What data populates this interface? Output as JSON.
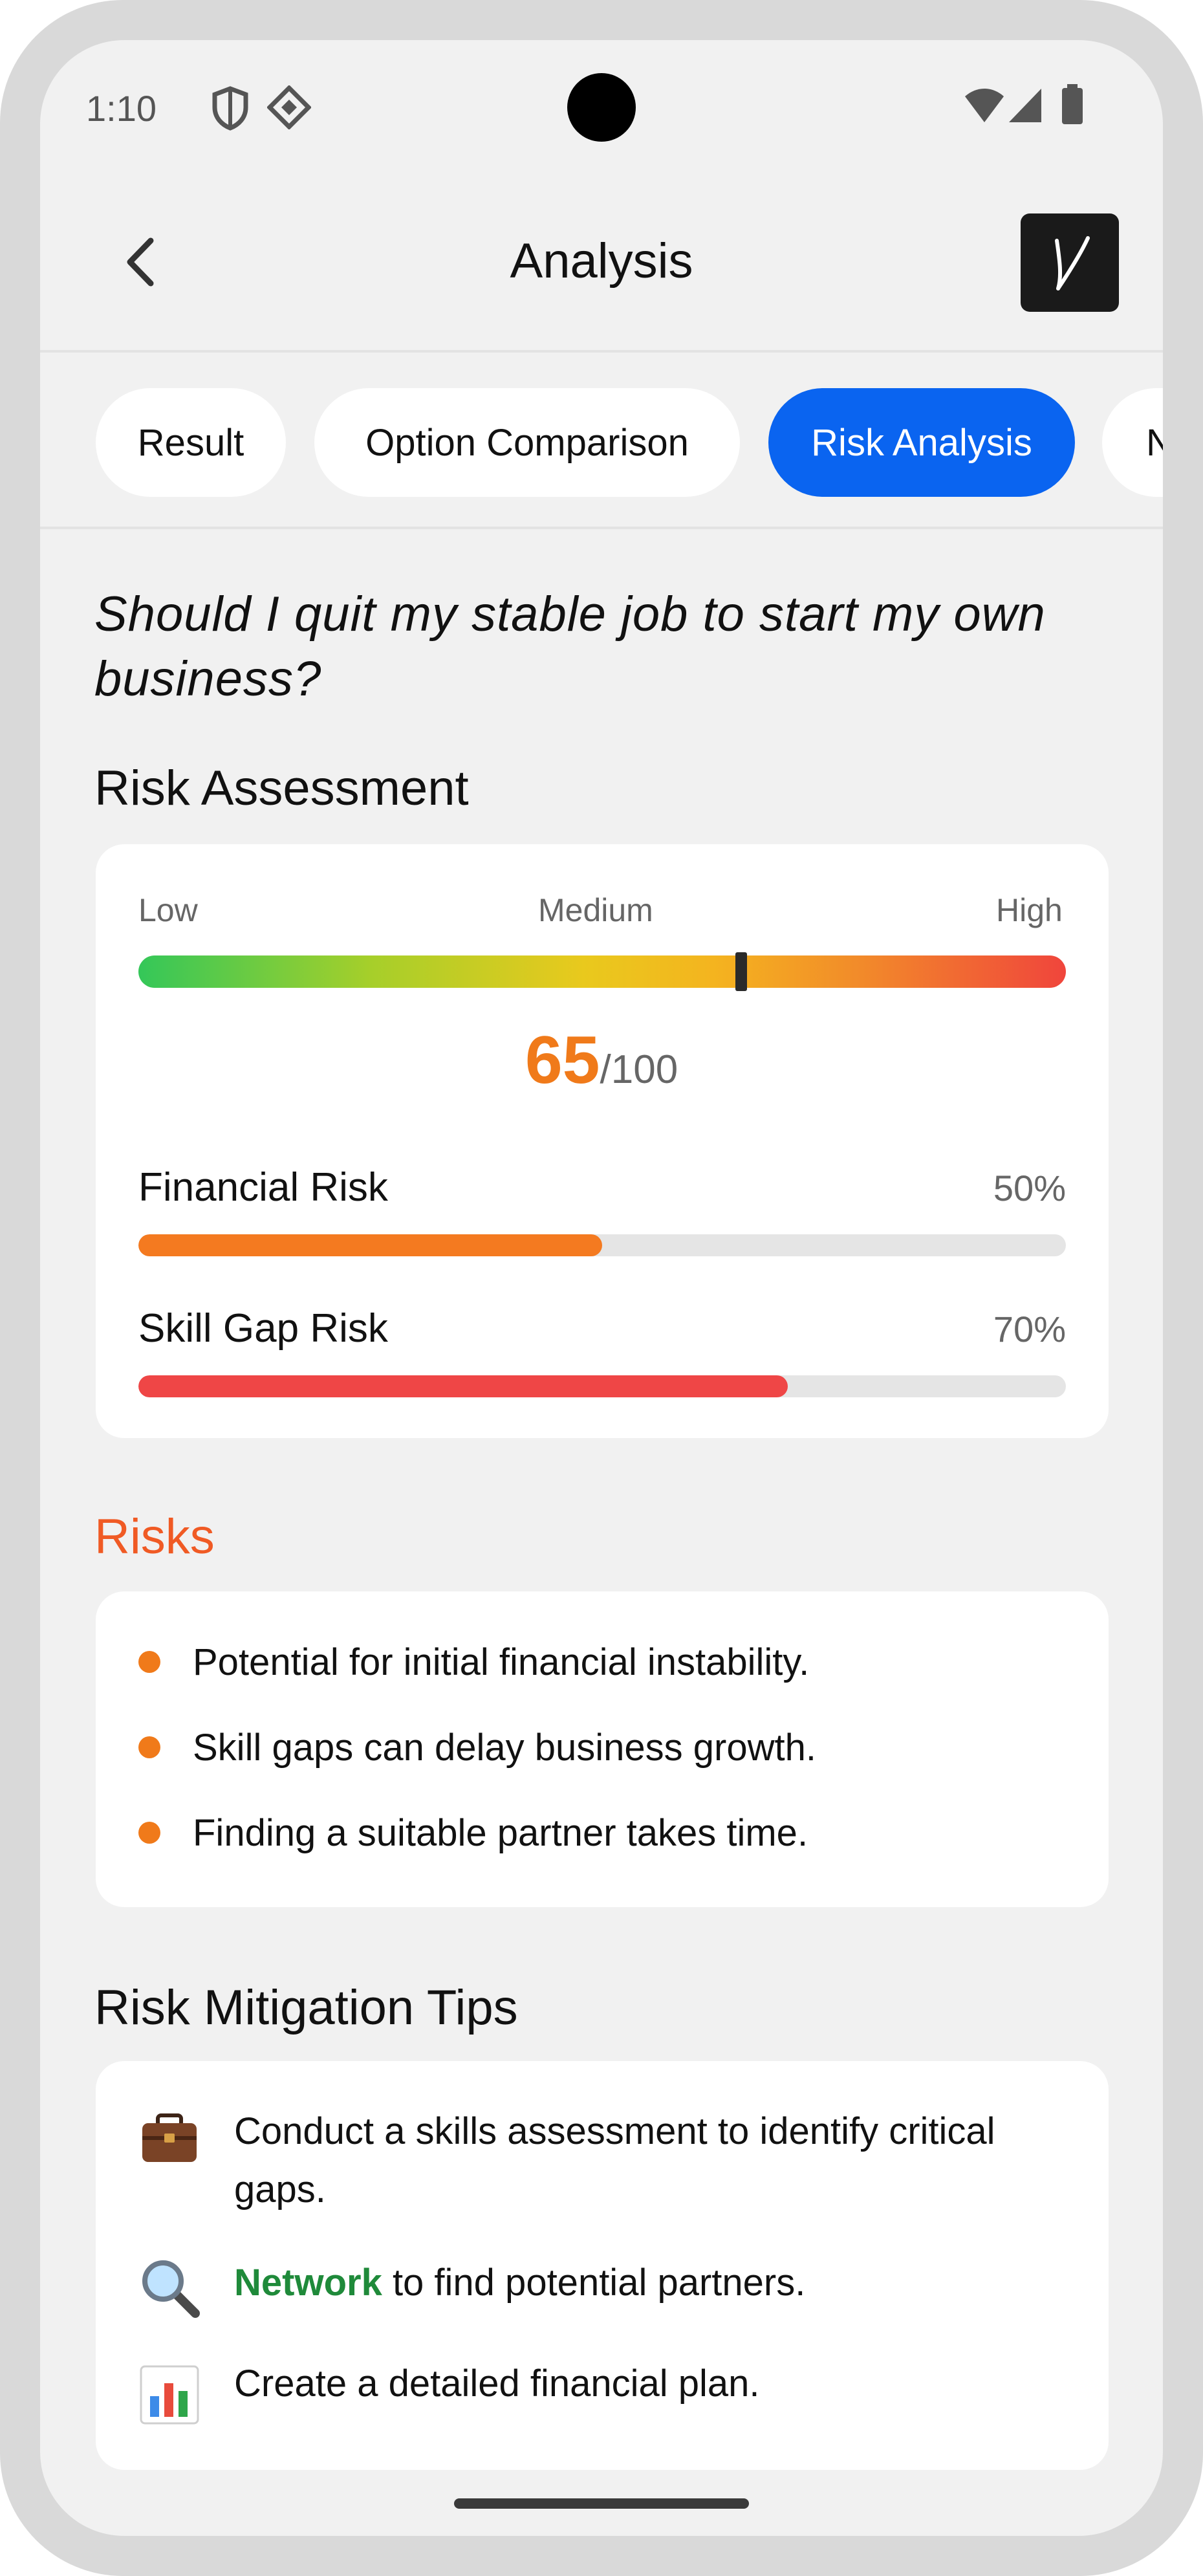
{
  "status_bar": {
    "time": "1:10",
    "left_icons": [
      "shield-icon",
      "diamond-grid-icon"
    ],
    "right_icons": [
      "wifi-icon",
      "signal-icon",
      "battery-icon"
    ]
  },
  "app_bar": {
    "back_icon": "chevron-left-icon",
    "title": "Analysis",
    "logo_glyph": "V"
  },
  "tabs": [
    {
      "label": "Result",
      "active": false
    },
    {
      "label": "Option Comparison",
      "active": false
    },
    {
      "label": "Risk Analysis",
      "active": true
    },
    {
      "label": "N",
      "active": false
    }
  ],
  "question": "Should I quit my stable job to start my own business?",
  "risk_assessment": {
    "title": "Risk Assessment",
    "scale": {
      "low": "Low",
      "medium": "Medium",
      "high": "High"
    },
    "score": "65",
    "score_max": "/100",
    "score_fraction": 0.65,
    "metrics": [
      {
        "label": "Financial Risk",
        "percent": "50%",
        "value": 0.5,
        "color": "#f47a20"
      },
      {
        "label": "Skill Gap Risk",
        "percent": "70%",
        "value": 0.7,
        "color": "#ef4646"
      }
    ]
  },
  "risks": {
    "title": "Risks",
    "items": [
      "Potential for initial financial instability.",
      "Skill gaps can delay business growth.",
      "Finding a suitable partner takes time."
    ]
  },
  "mitigation": {
    "title": "Risk Mitigation Tips",
    "tips": [
      {
        "icon": "briefcase-icon",
        "highlight": "",
        "text": "Conduct a skills assessment to identify critical gaps."
      },
      {
        "icon": "magnifier-icon",
        "highlight": "Network",
        "text": " to find potential partners."
      },
      {
        "icon": "bar-chart-icon",
        "highlight": "",
        "text": "Create a detailed financial plan."
      }
    ]
  },
  "colors": {
    "accent_blue": "#0a64f0",
    "risk_orange": "#f07a1a",
    "risk_red": "#ef4646",
    "risks_heading": "#f05a24",
    "highlight_green": "#1f8a3a"
  }
}
